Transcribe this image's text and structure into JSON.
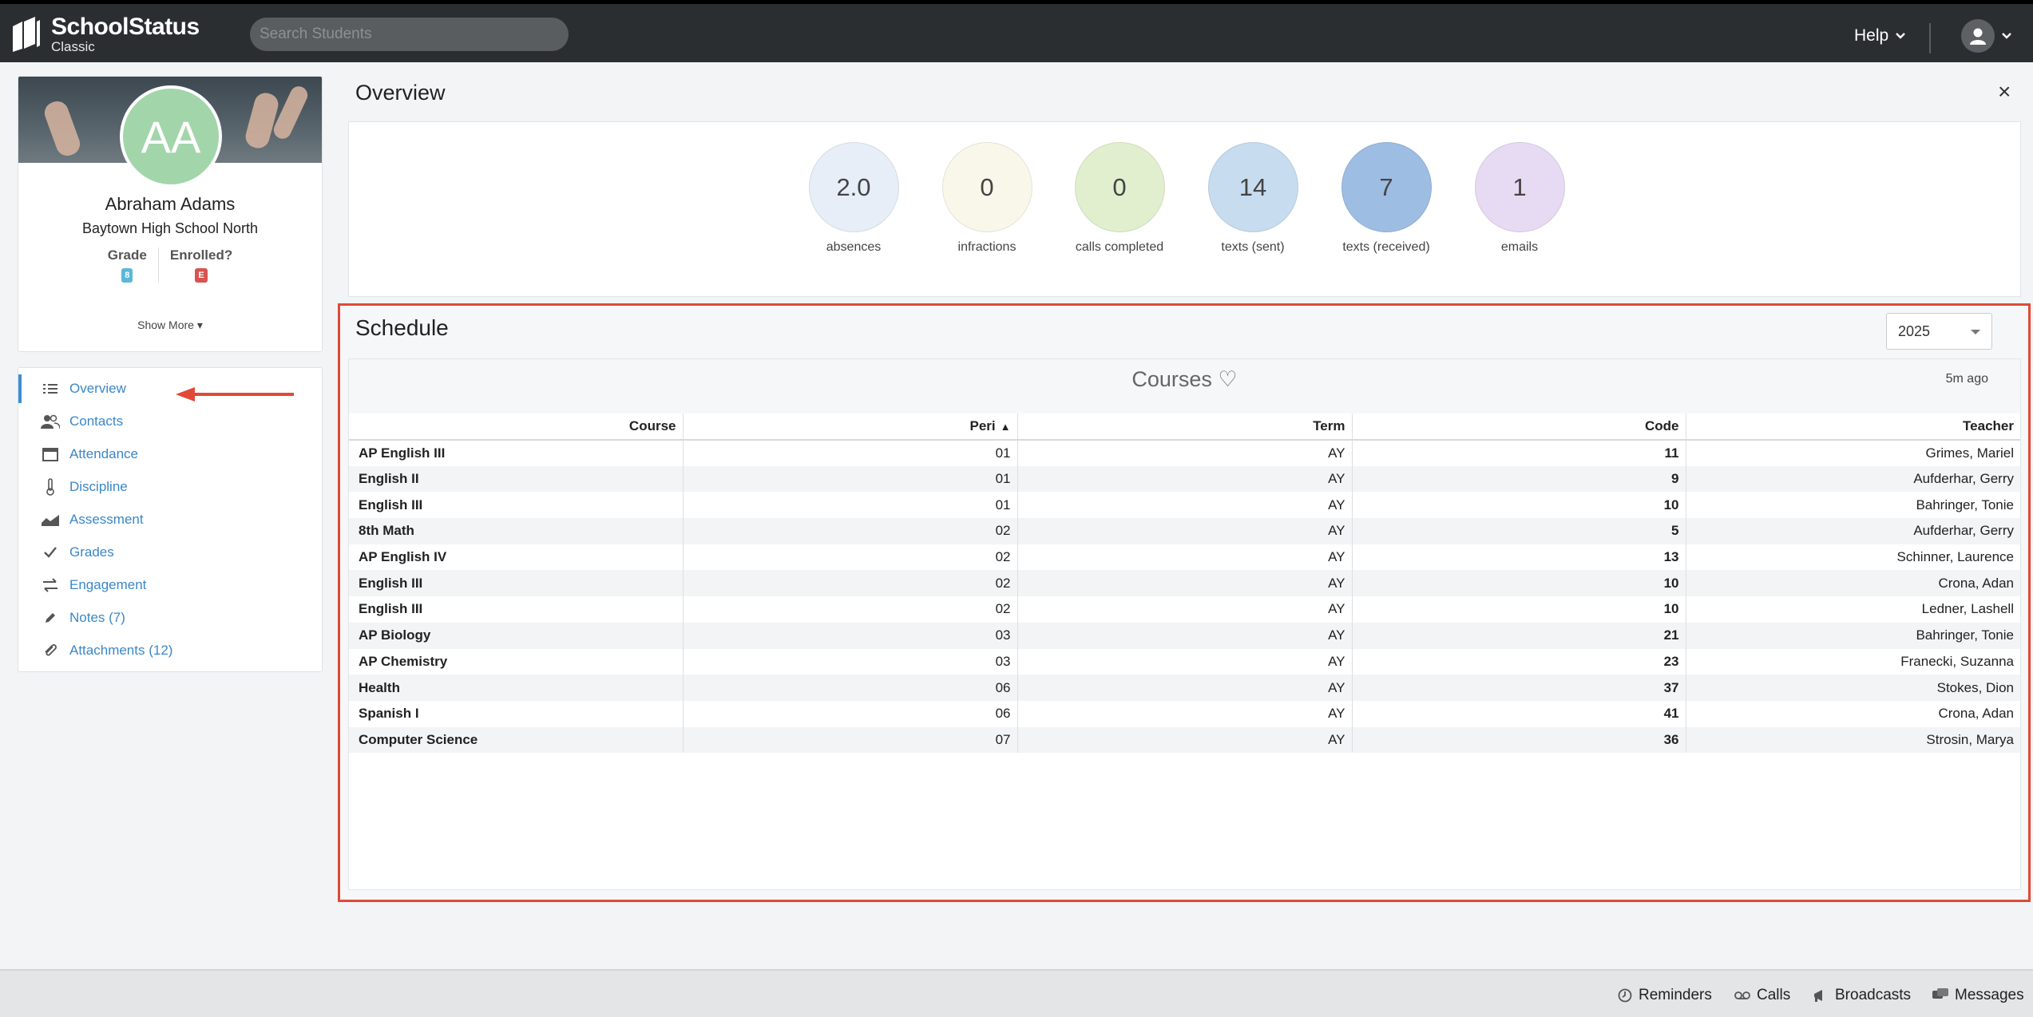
{
  "header": {
    "app_name": "SchoolStatus",
    "app_sub": "Classic",
    "search_placeholder": "Search Students",
    "help_label": "Help"
  },
  "student": {
    "initials": "AA",
    "name": "Abraham Adams",
    "school": "Baytown High School North",
    "grade_label": "Grade",
    "grade_value": "8",
    "enrolled_label": "Enrolled?",
    "enrolled_value": "E",
    "show_more": "Show More ▾"
  },
  "nav": [
    {
      "label": "Overview",
      "icon": "list-icon",
      "active": true
    },
    {
      "label": "Contacts",
      "icon": "contacts-icon"
    },
    {
      "label": "Attendance",
      "icon": "calendar-icon"
    },
    {
      "label": "Discipline",
      "icon": "thermometer-icon"
    },
    {
      "label": "Assessment",
      "icon": "chart-icon"
    },
    {
      "label": "Grades",
      "icon": "check-icon"
    },
    {
      "label": "Engagement",
      "icon": "exchange-icon"
    },
    {
      "label": "Notes (7)",
      "icon": "pencil-icon"
    },
    {
      "label": "Attachments (12)",
      "icon": "paperclip-icon"
    }
  ],
  "overview": {
    "title": "Overview",
    "close": "×",
    "stats": [
      {
        "value": "2.0",
        "label": "absences",
        "color": "#e8eef7"
      },
      {
        "value": "0",
        "label": "infractions",
        "color": "#f9f7ea"
      },
      {
        "value": "0",
        "label": "calls completed",
        "color": "#e1efcf"
      },
      {
        "value": "14",
        "label": "texts (sent)",
        "color": "#c7dcef"
      },
      {
        "value": "7",
        "label": "texts (received)",
        "color": "#9dbde2"
      },
      {
        "value": "1",
        "label": "emails",
        "color": "#e6dbf2"
      }
    ]
  },
  "schedule": {
    "title": "Schedule",
    "year": "2025",
    "courses_title": "Courses ♡",
    "updated": "5m ago",
    "columns": [
      "Course",
      "Peri",
      "Term",
      "Code",
      "Teacher"
    ],
    "sort_indicator": "^",
    "rows": [
      [
        "AP English III",
        "01",
        "AY",
        "11",
        "Grimes, Mariel"
      ],
      [
        "English II",
        "01",
        "AY",
        "9",
        "Aufderhar, Gerry"
      ],
      [
        "English III",
        "01",
        "AY",
        "10",
        "Bahringer, Tonie"
      ],
      [
        "8th Math",
        "02",
        "AY",
        "5",
        "Aufderhar, Gerry"
      ],
      [
        "AP English IV",
        "02",
        "AY",
        "13",
        "Schinner, Laurence"
      ],
      [
        "English III",
        "02",
        "AY",
        "10",
        "Crona, Adan"
      ],
      [
        "English III",
        "02",
        "AY",
        "10",
        "Ledner, Lashell"
      ],
      [
        "AP Biology",
        "03",
        "AY",
        "21",
        "Bahringer, Tonie"
      ],
      [
        "AP Chemistry",
        "03",
        "AY",
        "23",
        "Franecki, Suzanna"
      ],
      [
        "Health",
        "06",
        "AY",
        "37",
        "Stokes, Dion"
      ],
      [
        "Spanish I",
        "06",
        "AY",
        "41",
        "Crona, Adan"
      ],
      [
        "Computer Science",
        "07",
        "AY",
        "36",
        "Strosin, Marya"
      ]
    ]
  },
  "footer": {
    "items": [
      {
        "label": "Reminders",
        "icon": "clock-icon"
      },
      {
        "label": "Calls",
        "icon": "voicemail-icon"
      },
      {
        "label": "Broadcasts",
        "icon": "megaphone-icon"
      },
      {
        "label": "Messages",
        "icon": "chat-icon"
      }
    ]
  },
  "colors": {
    "accent": "#3a87c8",
    "highlight_border": "#e04a36",
    "topbar": "#2b2e31"
  }
}
